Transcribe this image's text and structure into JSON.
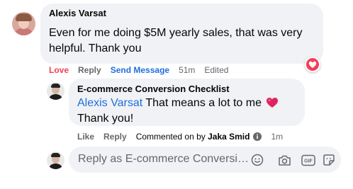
{
  "comment": {
    "author": "Alexis Varsat",
    "text": "Even for me doing $5M yearly sales, that was very helpful. Thank you",
    "actions": {
      "love": "Love",
      "reply": "Reply",
      "send_message": "Send Message",
      "time": "51m",
      "edited": "Edited"
    },
    "reaction": "love"
  },
  "reply": {
    "author": "E-commerce Conversion Checklist",
    "mention": "Alexis Varsat",
    "text_before_heart": " That means a lot to me ",
    "text_after_heart": " Thank you!",
    "actions": {
      "like": "Like",
      "reply": "Reply",
      "commented_prefix": "Commented on by ",
      "commented_by": "Jaka Smid",
      "time": "1m"
    }
  },
  "reply_box": {
    "placeholder": "Reply as E-commerce Conversi…",
    "tools": [
      "emoji-icon",
      "camera-icon",
      "gif-icon",
      "sticker-icon"
    ]
  },
  "colors": {
    "link_blue": "#216fdb",
    "love_red": "#f33e58",
    "muted_gray": "#65676b",
    "bubble_bg": "#f0f2f5"
  }
}
